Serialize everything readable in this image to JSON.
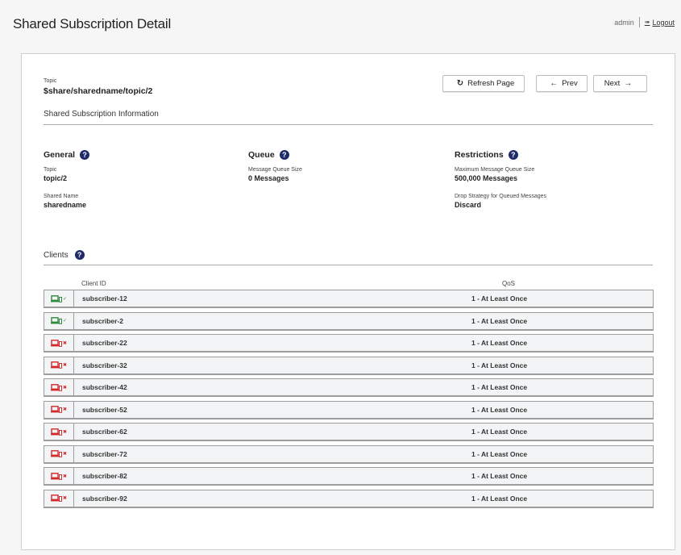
{
  "header": {
    "title": "Shared Subscription Detail",
    "username": "admin",
    "logout_label": "Logout",
    "logout_icon": "sign-out-icon"
  },
  "topic": {
    "label": "Topic",
    "value": "$share/sharedname/topic/2"
  },
  "toolbar": {
    "refresh_label": "Refresh Page",
    "refresh_icon": "refresh-icon",
    "prev_label": "Prev",
    "prev_icon": "arrow-left-icon",
    "next_label": "Next",
    "next_icon": "arrow-right-icon"
  },
  "info_section": {
    "title": "Shared Subscription Information"
  },
  "general": {
    "title": "General",
    "topic_label": "Topic",
    "topic_value": "topic/2",
    "shared_name_label": "Shared Name",
    "shared_name_value": "sharedname"
  },
  "queue": {
    "title": "Queue",
    "size_label": "Message Queue Size",
    "size_value": "0 Messages"
  },
  "restrictions": {
    "title": "Restrictions",
    "max_label": "Maximum Message Queue Size",
    "max_value": "500,000 Messages",
    "drop_label": "Drop Strategy for Queued Messages",
    "drop_value": "Discard"
  },
  "clients": {
    "title": "Clients",
    "columns": {
      "client_id": "Client ID",
      "qos": "QoS"
    },
    "colors": {
      "connected": "#2c8a3a",
      "disconnected": "#d22a2a"
    },
    "rows": [
      {
        "client_id": "subscriber-12",
        "qos": "1 - At Least Once",
        "connected": true
      },
      {
        "client_id": "subscriber-2",
        "qos": "1 - At Least Once",
        "connected": true
      },
      {
        "client_id": "subscriber-22",
        "qos": "1 - At Least Once",
        "connected": false
      },
      {
        "client_id": "subscriber-32",
        "qos": "1 - At Least Once",
        "connected": false
      },
      {
        "client_id": "subscriber-42",
        "qos": "1 - At Least Once",
        "connected": false
      },
      {
        "client_id": "subscriber-52",
        "qos": "1 - At Least Once",
        "connected": false
      },
      {
        "client_id": "subscriber-62",
        "qos": "1 - At Least Once",
        "connected": false
      },
      {
        "client_id": "subscriber-72",
        "qos": "1 - At Least Once",
        "connected": false
      },
      {
        "client_id": "subscriber-82",
        "qos": "1 - At Least Once",
        "connected": false
      },
      {
        "client_id": "subscriber-92",
        "qos": "1 - At Least Once",
        "connected": false
      }
    ]
  }
}
